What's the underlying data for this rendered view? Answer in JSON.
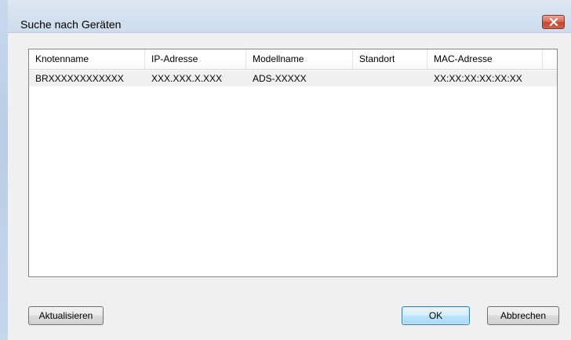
{
  "window": {
    "title": "Suche nach Geräten"
  },
  "icons": {
    "close": "close-icon"
  },
  "listview": {
    "columns": [
      "Knotenname",
      "IP-Adresse",
      "Modellname",
      "Standort",
      "MAC-Adresse"
    ],
    "rows": [
      [
        "BRXXXXXXXXXXXX",
        "XXX.XXX.X.XXX",
        "ADS-XXXXX",
        "",
        "XX:XX:XX:XX:XX:XX"
      ]
    ]
  },
  "buttons": {
    "refresh_label": "Aktualisieren",
    "ok_label": "OK",
    "cancel_label": "Abbrechen"
  },
  "colors": {
    "title_bar": "#d3e0ef",
    "close_button": "#c7452c",
    "selected_row": "#f0f0f0"
  }
}
